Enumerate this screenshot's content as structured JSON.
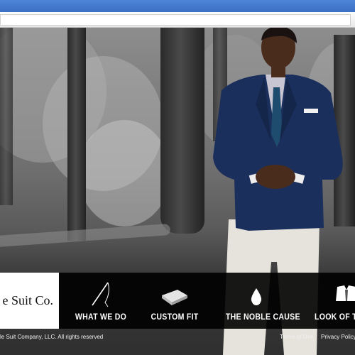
{
  "brand": {
    "logo_text": "e Suit Co."
  },
  "nav": {
    "items": [
      {
        "label": "WHAT WE DO",
        "icon": "needle-thread-icon"
      },
      {
        "label": "CUSTOM FIT",
        "icon": "folded-fabric-icon"
      },
      {
        "label": "THE NOBLE CAUSE",
        "icon": "drop-icon"
      },
      {
        "label": "LOOK OF TH",
        "icon": "shirt-tie-icon"
      }
    ]
  },
  "footer": {
    "copyright": "le Suit Company, LLC. All rights reserved",
    "terms_label": "Terms of Use",
    "privacy_label": "Privacy Policy"
  },
  "colors": {
    "browser_titlebar": "#3f74c9",
    "nav_background": "#000000",
    "nav_text": "#ffffff",
    "logo_background": "#ffffff",
    "suit_blue": "#1b2f5c"
  }
}
